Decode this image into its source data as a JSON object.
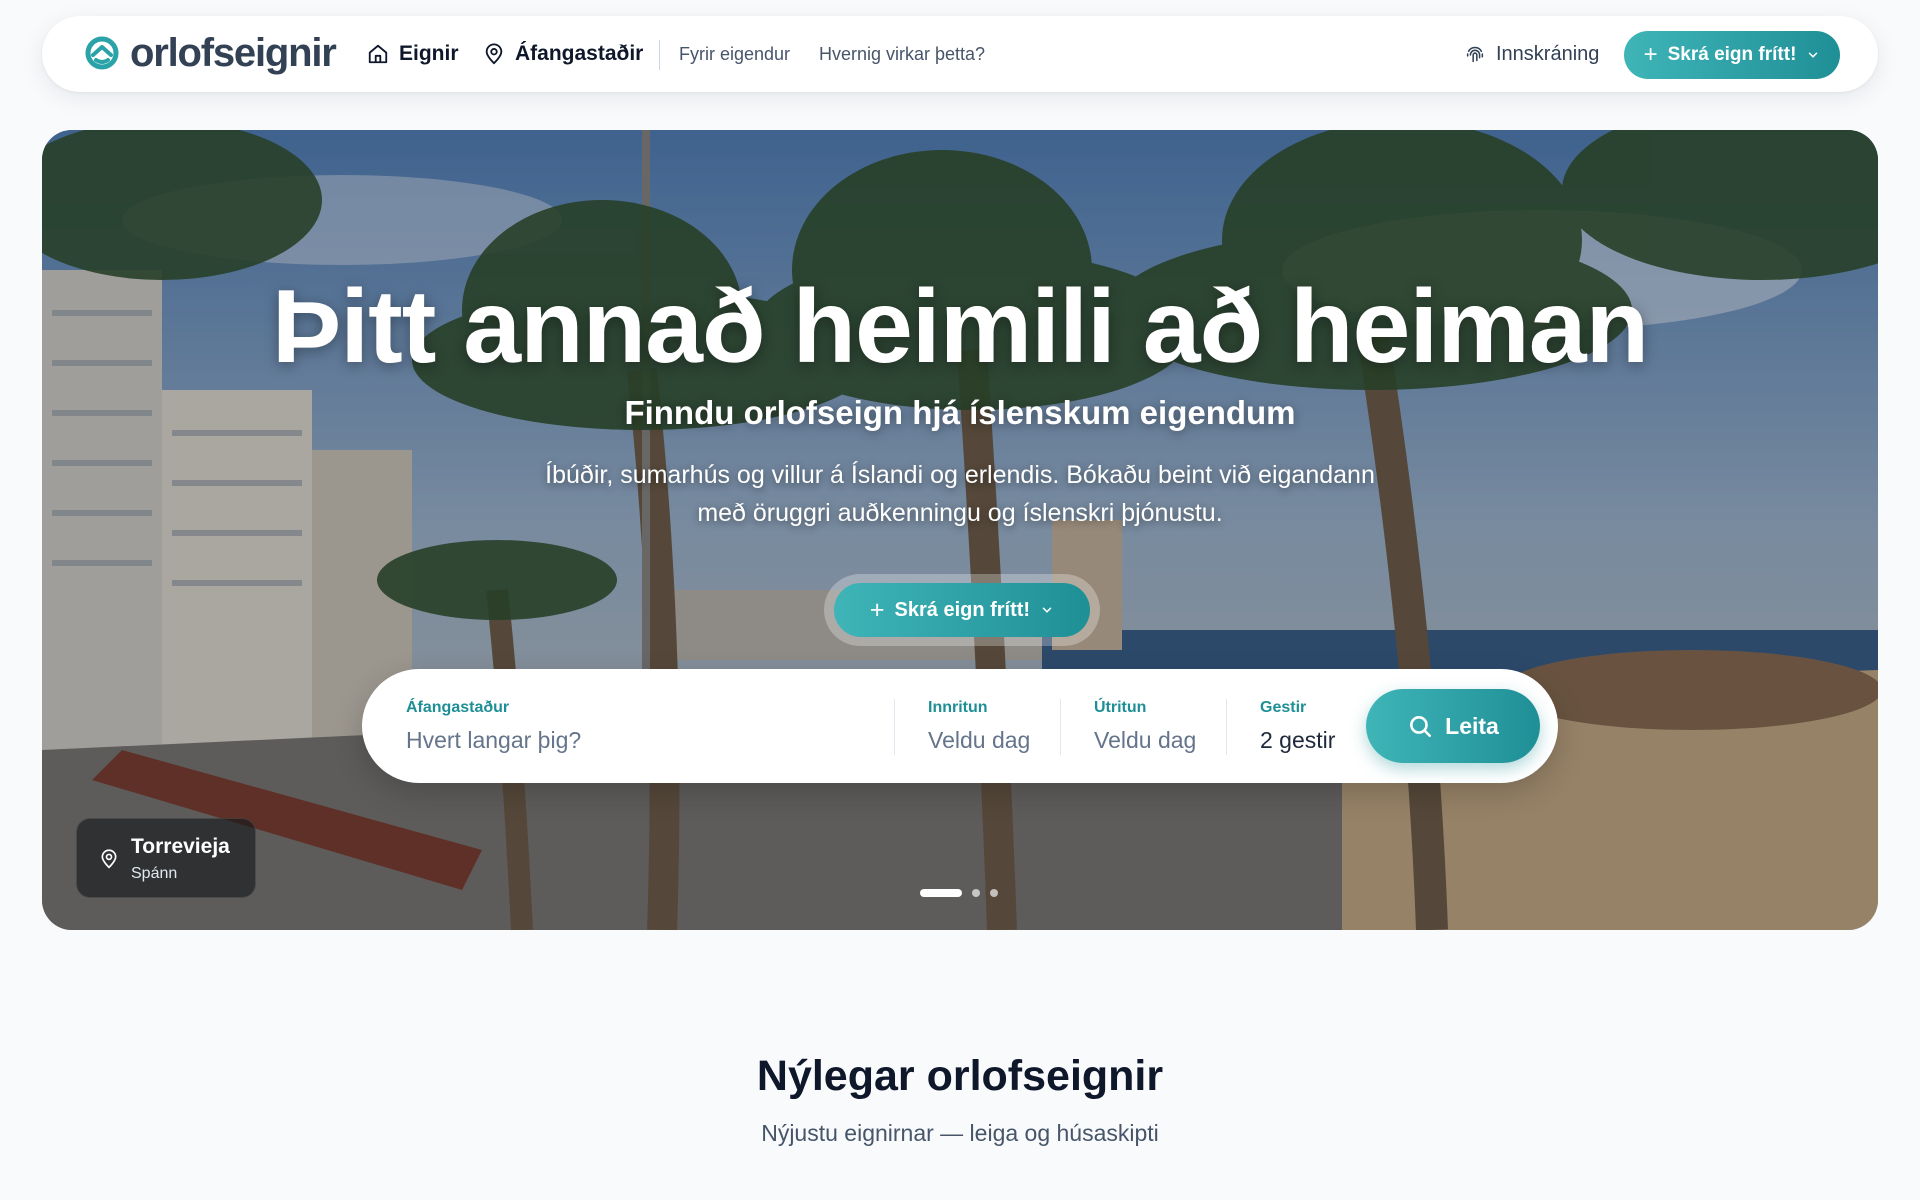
{
  "brand": {
    "logo_text": "orlofseignir",
    "accent_color": "#2aa3a8",
    "dark_text_color": "#0f172a"
  },
  "nav": {
    "links": [
      {
        "label": "Eignir",
        "icon": "home-icon"
      },
      {
        "label": "Áfangastaðir",
        "icon": "map-pin-icon"
      },
      {
        "label": "Fyrir eigendur"
      },
      {
        "label": "Hvernig virkar þetta?"
      }
    ],
    "login_label": "Innskráning",
    "login_icon": "fingerprint-icon",
    "cta_label": "Skrá eign frítt!"
  },
  "hero": {
    "title": "Þitt annað heimili að heiman",
    "subtitle": "Finndu orlofseign hjá íslenskum eigendum",
    "description_line1": "Íbúðir, sumarhús og villur á Íslandi og erlendis. Bókaðu beint við eigandann",
    "description_line2": "með öruggri auðkenningu og íslenskri þjónustu.",
    "cta_label": "Skrá eign frítt!",
    "location": {
      "city": "Torrevieja",
      "country": "Spánn"
    },
    "slides": {
      "count": 3,
      "active_index": 0
    }
  },
  "search": {
    "destination": {
      "label": "Áfangastaður",
      "placeholder": "Hvert langar þig?"
    },
    "checkin": {
      "label": "Innritun",
      "value": "Veldu dag"
    },
    "checkout": {
      "label": "Útritun",
      "value": "Veldu dag"
    },
    "guests": {
      "label": "Gestir",
      "value": "2 gestir"
    },
    "button_label": "Leita"
  },
  "recent": {
    "title": "Nýlegar orlofseignir",
    "subtitle": "Nýjustu eignirnar — leiga og húsaskipti"
  }
}
